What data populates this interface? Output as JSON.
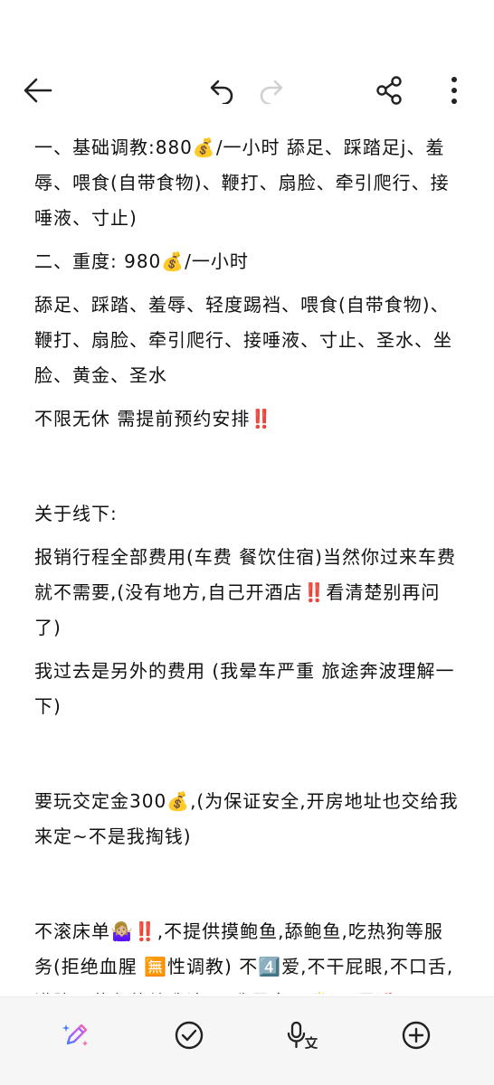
{
  "toolbar": {
    "back_icon": "arrow-left-icon",
    "undo_icon": "undo-icon",
    "redo_icon": "redo-icon",
    "share_icon": "share-icon",
    "more_icon": "more-vertical-icon"
  },
  "note": {
    "lines": [
      "一、基础调教:880💰/一小时 舔足、踩踏足j、羞辱、喂食(自带食物)、鞭打、扇脸、牵引爬行、接唾液、寸止)",
      "二、重度: 980💰/一小时",
      "舔足、踩踏、羞辱、轻度踢裆、喂食(自带食物)、鞭打、扇脸、牵引爬行、接唾液、寸止、圣水、坐脸、黄金、圣水",
      "不限无休 需提前预约安排‼️",
      "",
      "关于线下:",
      "报销行程全部费用(车费 餐饮住宿)当然你过来车费就不需要,(没有地方,自己开酒店‼️看清楚别再问了)",
      "我过去是另外的费用 (我晕车严重 旅途奔波理解一下)",
      "",
      "要玩交定金300💰,(为保证安全,开房地址也交给我来定~不是我掏钱)",
      "",
      "不滚床单🤷🏼‍♀️‼️,不提供摸鲍鱼,舔鲍鱼,吃热狗等服务(拒绝血腥 🈚性调教) 不4️⃣爱,不干屁眼,不口舌,满脑子黄色的给我滚开)我是女王👸🏻 不是🐔!"
    ]
  },
  "bottom_toolbar": {
    "pen_icon": "pen-sparkle-icon",
    "check_icon": "check-circle-icon",
    "voice_icon": "voice-to-text-icon",
    "add_icon": "plus-circle-icon"
  }
}
